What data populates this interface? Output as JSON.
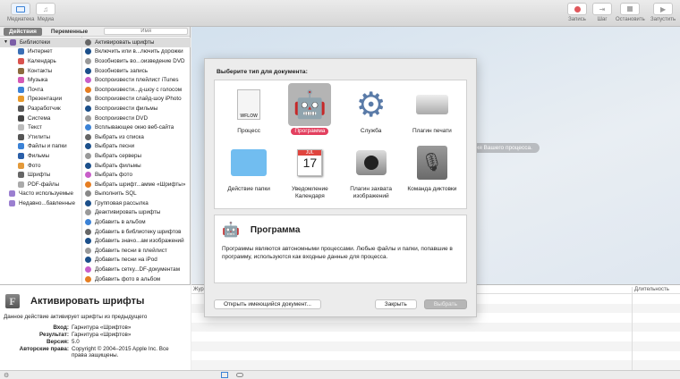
{
  "toolbar": {
    "left": [
      {
        "label": "Медиатека",
        "icon": "library-icon"
      },
      {
        "label": "Медиа",
        "icon": "music-icon"
      }
    ],
    "right": [
      {
        "label": "Запись",
        "icon": "record-icon"
      },
      {
        "label": "Шаг",
        "icon": "step-icon"
      },
      {
        "label": "Остановить",
        "icon": "stop-icon"
      },
      {
        "label": "Запустить",
        "icon": "play-icon"
      }
    ]
  },
  "tabs": {
    "actions": "Действия",
    "variables": "Переменные",
    "search_placeholder": "Имя"
  },
  "libraries": [
    "Библиотеки",
    "Интернет",
    "Календарь",
    "Контакты",
    "Музыка",
    "Почта",
    "Презентации",
    "Разработчик",
    "Система",
    "Текст",
    "Утилиты",
    "Файлы и папки",
    "Фильмы",
    "Фото",
    "Шрифты",
    "PDF-файлы",
    "Часто используемые",
    "Недавно...бавленные"
  ],
  "actions": [
    "Активировать шрифты",
    "Включить или в...лючить дорожки",
    "Возобновить во...оизведение DVD",
    "Возобновить запись",
    "Воспроизвести плейлист iTunes",
    "Воспроизвести...д-шоу с голосом",
    "Воспроизвести слайд-шоу iPhoto",
    "Воспроизвести фильмы",
    "Воспроизвести DVD",
    "Всплывающее окно веб-сайта",
    "Выбрать из списка",
    "Выбрать песни",
    "Выбрать серверы",
    "Выбрать фильмы",
    "Выбрать фото",
    "Выбрать шрифт...амме «Шрифты»",
    "Выполнить SQL",
    "Групповая рассылка",
    "Деактивировать шрифты",
    "Добавить в альбом",
    "Добавить в библиотеку шрифтов",
    "Добавить значо...ам изображений",
    "Добавить песни в плейлист",
    "Добавить песни на iPod",
    "Добавить сетку...DF-документам",
    "Добавить фото в альбом"
  ],
  "description": {
    "title": "Активировать шрифты",
    "text": "Данное действие активирует шрифты из предыдущего",
    "fields": [
      {
        "k": "Вход:",
        "v": "Гарнитура «Шрифтов»"
      },
      {
        "k": "Результат:",
        "v": "Гарнитура «Шрифтов»"
      },
      {
        "k": "Версия:",
        "v": "5.0"
      },
      {
        "k": "Авторские права:",
        "v": "Copyright © 2004–2015 Apple Inc. Все права защищены."
      }
    ]
  },
  "workflow_hint": "ния Вашего процесса.",
  "log": {
    "col1": "Журнал",
    "col2": "Длительность"
  },
  "dialog": {
    "title": "Выберите тип для документа:",
    "types": [
      {
        "label": "Процесс",
        "icon": "workflow-file-icon"
      },
      {
        "label": "Программа",
        "icon": "automator-robot-icon",
        "selected": true
      },
      {
        "label": "Служба",
        "icon": "gear-icon"
      },
      {
        "label": "Плагин печати",
        "icon": "printer-icon"
      },
      {
        "label": "Действие папки",
        "icon": "folder-icon"
      },
      {
        "label": "Уведомление Календаря",
        "icon": "calendar-icon",
        "cal_month": "JUL",
        "cal_day": "17"
      },
      {
        "label": "Плагин захвата изображений",
        "icon": "camera-icon"
      },
      {
        "label": "Команда диктовки",
        "icon": "microphone-icon"
      }
    ],
    "wflow": "WFLOW",
    "info_title": "Программа",
    "info_text": "Программы являются автономными процессами. Любые файлы и папки, попавшие в программу, используются как входные данные для процесса.",
    "open_button": "Открыть имеющийся документ...",
    "close_button": "Закрыть",
    "choose_button": "Выбрать"
  }
}
